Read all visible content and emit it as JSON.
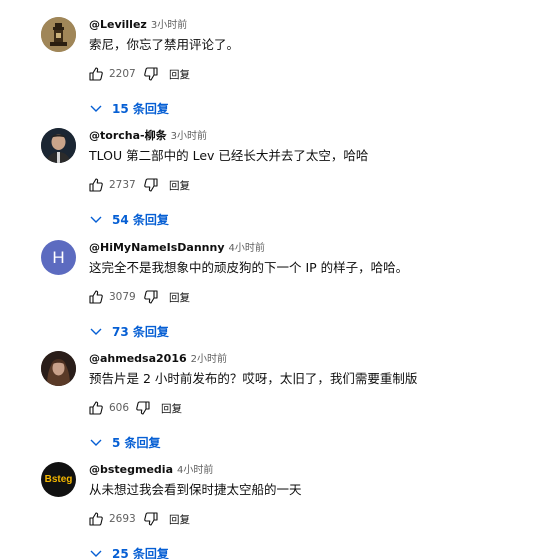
{
  "comments": [
    {
      "author": "@Levillez",
      "time": "3小时前",
      "text": "索尼，你忘了禁用评论了。",
      "likes": "2207",
      "reply_label": "回复",
      "replies_label": "15 条回复",
      "avatar_icon": "tower-avatar-icon",
      "avatar_color": "#8a7345"
    },
    {
      "author": "@torcha-柳条",
      "time": "3小时前",
      "text": "TLOU 第二部中的 Lev 已经长大并去了太空，哈哈",
      "likes": "2737",
      "reply_label": "回复",
      "replies_label": "54 条回复",
      "avatar_icon": "person-photo-avatar-icon",
      "avatar_color": "#1b2633"
    },
    {
      "author": "@HiMyNameIsDannny",
      "time": "4小时前",
      "text": "这完全不是我想象中的顽皮狗的下一个 IP 的样子，哈哈。",
      "likes": "3079",
      "reply_label": "回复",
      "replies_label": "73 条回复",
      "avatar_letter": "H",
      "avatar_color": "#5c6bc0"
    },
    {
      "author": "@ahmedsa2016",
      "time": "2小时前",
      "text": "预告片是 2 小时前发布的？哎呀，太旧了，我们需要重制版",
      "likes": "606",
      "reply_label": "回复",
      "replies_label": "5 条回复",
      "avatar_icon": "woman-photo-avatar-icon",
      "avatar_color": "#3a2a22"
    },
    {
      "author": "@bstegmedia",
      "time": "4小时前",
      "text": "从未想过我会看到保时捷太空船的一天",
      "likes": "2693",
      "reply_label": "回复",
      "replies_label": "25 条回复",
      "avatar_letter": "Bsteg",
      "avatar_color": "#111111"
    }
  ],
  "colors": {
    "link": "#065fd4",
    "muted": "#606060",
    "text": "#0f0f0f"
  }
}
